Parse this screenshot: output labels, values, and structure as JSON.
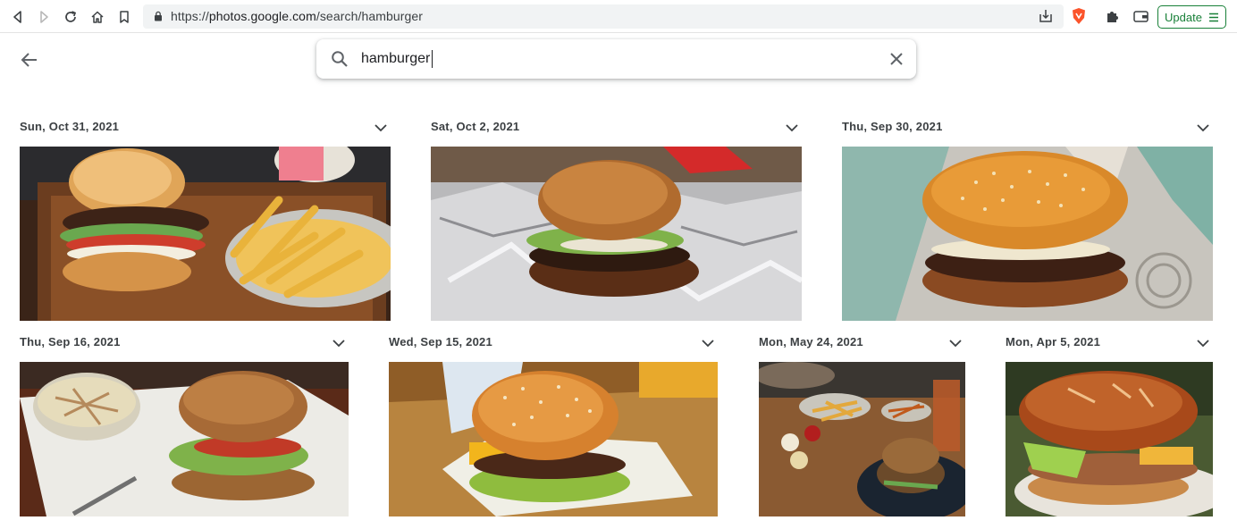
{
  "browser": {
    "url_scheme": "https://",
    "url_host": "photos.google.com",
    "url_path": "/search/hamburger",
    "update_label": "Update"
  },
  "search": {
    "query": "hamburger"
  },
  "results": [
    {
      "date": "Sun, Oct 31, 2021"
    },
    {
      "date": "Sat, Oct 2, 2021"
    },
    {
      "date": "Thu, Sep 30, 2021"
    },
    {
      "date": "Thu, Sep 16, 2021"
    },
    {
      "date": "Wed, Sep 15, 2021"
    },
    {
      "date": "Mon, May 24, 2021"
    },
    {
      "date": "Mon, Apr 5, 2021"
    }
  ],
  "colors": {
    "update_green": "#188038",
    "brave_orange": "#fb542b",
    "bun": "#c7843b",
    "patty": "#4a2a1a"
  }
}
